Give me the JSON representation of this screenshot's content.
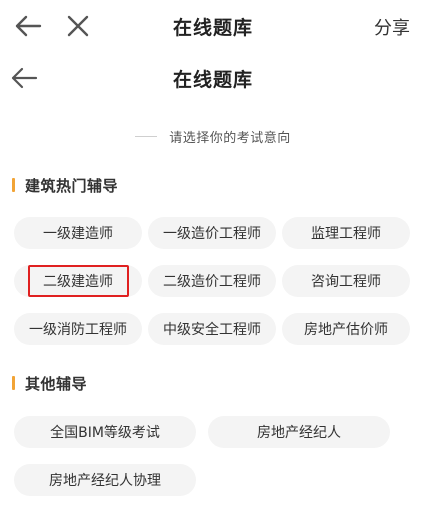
{
  "topbar": {
    "title": "在线题库",
    "share_label": "分享",
    "back_icon": "back-arrow-icon",
    "close_icon": "close-icon"
  },
  "header": {
    "title": "在线题库",
    "back_icon": "back-arrow-icon"
  },
  "subtitle": "请选择你的考试意向",
  "sections": [
    {
      "title": "建筑热门辅导",
      "items": [
        "一级建造师",
        "一级造价工程师",
        "监理工程师",
        "二级建造师",
        "二级造价工程师",
        "咨询工程师",
        "一级消防工程师",
        "中级安全工程师",
        "房地产估价师"
      ]
    },
    {
      "title": "其他辅导",
      "items": [
        "全国BIM等级考试",
        "房地产经纪人",
        "房地产经纪人协理"
      ]
    }
  ],
  "highlighted_item": "二级建造师",
  "colors": {
    "accent": "#f2a436",
    "chip_bg": "#f4f4f4",
    "highlight": "#e02020"
  }
}
